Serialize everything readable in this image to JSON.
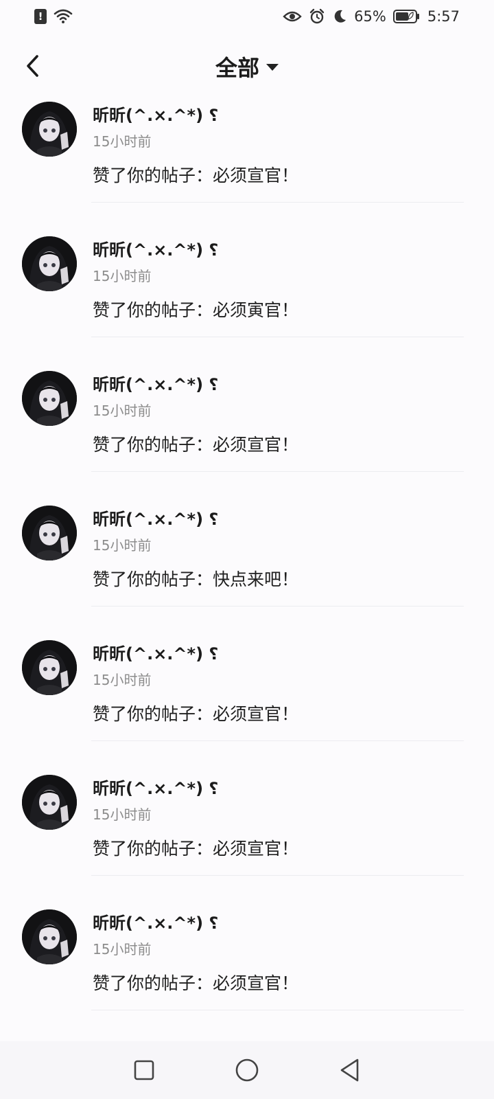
{
  "status_bar": {
    "battery_percent": "65%",
    "time": "5:57",
    "icons": [
      "sim-alert-icon",
      "wifi-icon",
      "eye-icon",
      "alarm-icon",
      "moon-icon",
      "battery-icon"
    ]
  },
  "header": {
    "title": "全部",
    "back_icon": "back-arrow-icon",
    "dropdown_icon": "caret-down-icon"
  },
  "notifications": [
    {
      "username": "昕昕(^.×.^*) ⸮",
      "time": "15小时前",
      "message": "赞了你的帖子：必须宣官！"
    },
    {
      "username": "昕昕(^.×.^*) ⸮",
      "time": "15小时前",
      "message": "赞了你的帖子：必须寅官！"
    },
    {
      "username": "昕昕(^.×.^*) ⸮",
      "time": "15小时前",
      "message": "赞了你的帖子：必须宣官！"
    },
    {
      "username": "昕昕(^.×.^*) ⸮",
      "time": "15小时前",
      "message": "赞了你的帖子：快点来吧！"
    },
    {
      "username": "昕昕(^.×.^*) ⸮",
      "time": "15小时前",
      "message": "赞了你的帖子：必须宣官！"
    },
    {
      "username": "昕昕(^.×.^*) ⸮",
      "time": "15小时前",
      "message": "赞了你的帖子：必须宣官！"
    },
    {
      "username": "昕昕(^.×.^*) ⸮",
      "time": "15小时前",
      "message": "赞了你的帖子：必须宣官！"
    }
  ],
  "nav_bar": {
    "icons": [
      "recent-apps-icon",
      "home-icon",
      "back-icon"
    ]
  }
}
